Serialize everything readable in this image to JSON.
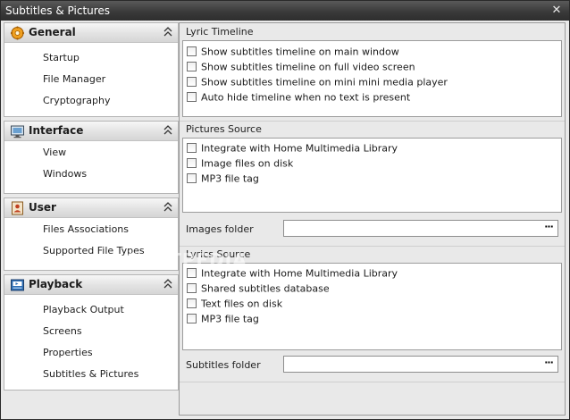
{
  "window": {
    "title": "Subtitles & Pictures",
    "close_glyph": "✕"
  },
  "nav": {
    "groups": [
      {
        "title": "General",
        "icon": "gear-icon",
        "items": [
          "Startup",
          "File Manager",
          "Cryptography"
        ]
      },
      {
        "title": "Interface",
        "icon": "monitor-icon",
        "items": [
          "View",
          "Windows"
        ]
      },
      {
        "title": "User",
        "icon": "user-card-icon",
        "items": [
          "Files Associations",
          "Supported File Types"
        ]
      },
      {
        "title": "Playback",
        "icon": "playback-icon",
        "items": [
          "Playback Output",
          "Screens",
          "Properties",
          "Subtitles & Pictures"
        ]
      }
    ]
  },
  "lyric_timeline": {
    "label": "Lyric Timeline",
    "options": [
      {
        "label": "Show subtitles timeline on main window",
        "checked": false
      },
      {
        "label": "Show subtitles timeline on full video screen",
        "checked": false
      },
      {
        "label": "Show subtitles timeline on mini mini media player",
        "checked": false
      },
      {
        "label": "Auto hide timeline when no text is present",
        "checked": false
      }
    ]
  },
  "pictures_source": {
    "label": "Pictures Source",
    "options": [
      {
        "label": "Integrate with Home Multimedia Library",
        "checked": false
      },
      {
        "label": "Image files on disk",
        "checked": false
      },
      {
        "label": "MP3 file tag",
        "checked": false
      }
    ],
    "folder_label": "Images folder",
    "folder_value": "",
    "browse_label": "···"
  },
  "lyrics_source": {
    "label": "Lyrics Source",
    "options": [
      {
        "label": "Integrate with Home Multimedia Library",
        "checked": false
      },
      {
        "label": "Shared subtitles database",
        "checked": false
      },
      {
        "label": "Text files on disk",
        "checked": false
      },
      {
        "label": "MP3 file tag",
        "checked": false
      }
    ],
    "folder_label": "Subtitles folder",
    "folder_value": "",
    "browse_label": "···"
  },
  "watermark": "SOFTPEDIA"
}
